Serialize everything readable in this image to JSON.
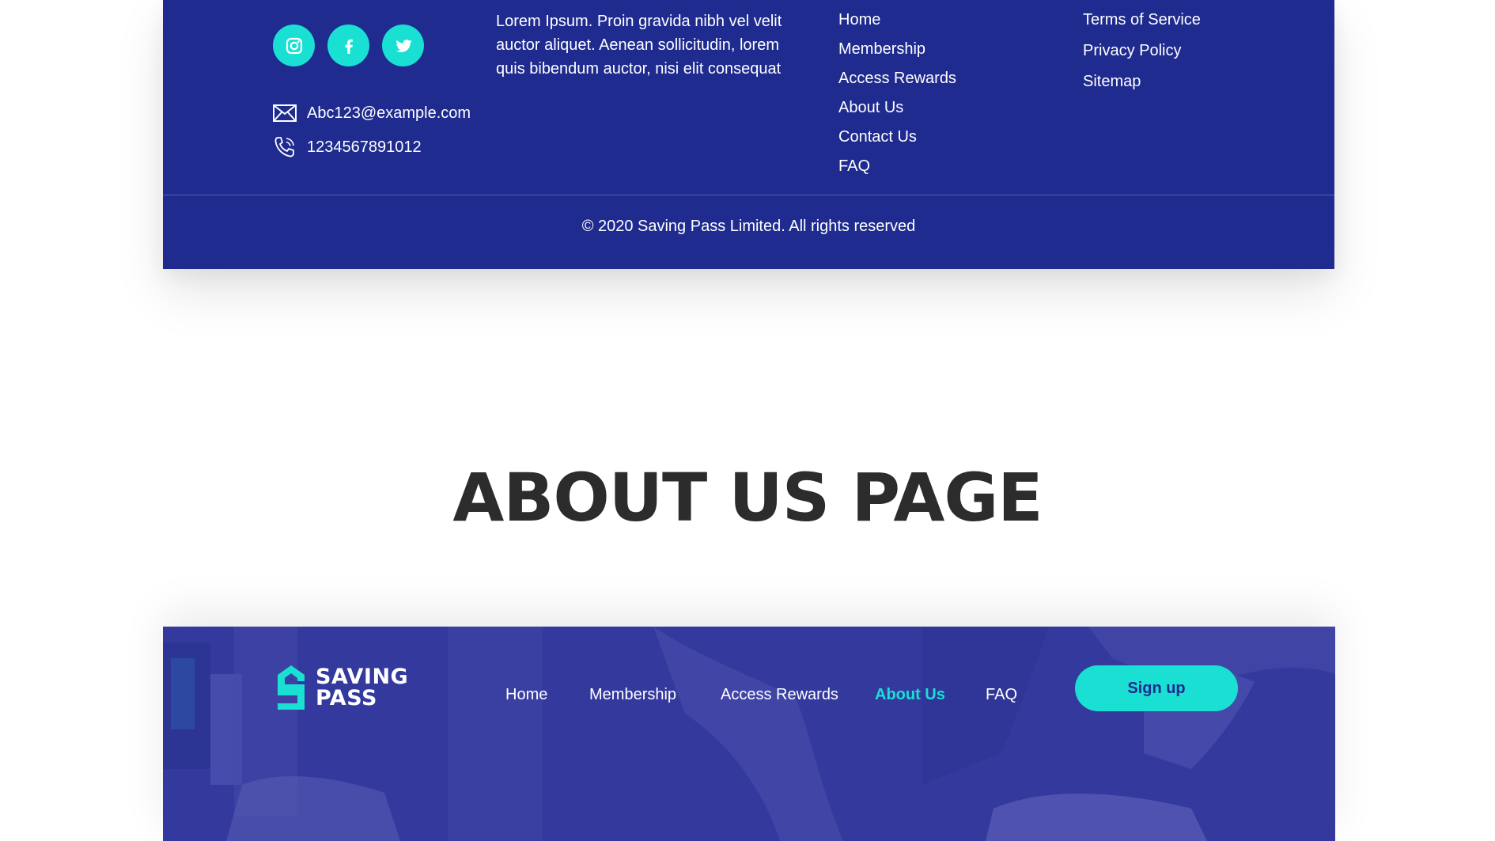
{
  "footer": {
    "social": [
      {
        "icon": "instagram-icon"
      },
      {
        "icon": "facebook-icon"
      },
      {
        "icon": "twitter-icon"
      }
    ],
    "email": "Abc123@example.com",
    "phone": "1234567891012",
    "blurb": "Lorem Ipsum. Proin gravida nibh vel velit auctor aliquet. Aenean sollicitudin, lorem quis bibendum auctor, nisi elit consequat",
    "links_primary": [
      "Home",
      "Membership",
      "Access Rewards",
      "About Us",
      "Contact Us",
      "FAQ"
    ],
    "links_legal": [
      "Terms of Service",
      "Privacy Policy",
      "Sitemap"
    ],
    "copyright": "© 2020 Saving Pass Limited. All rights reserved"
  },
  "section_heading": "ABOUT US PAGE",
  "header": {
    "logo_line1": "SAVING",
    "logo_line2": "PASS",
    "nav": [
      "Home",
      "Membership",
      "Access Rewards",
      "About Us",
      "FAQ"
    ],
    "active_nav": "About Us",
    "signup_label": "Sign up"
  },
  "colors": {
    "footer_bg": "#1f2b8f",
    "accent": "#19e0d2",
    "hero_overlay": "#34399e",
    "heading_text": "#2c2c2c"
  }
}
